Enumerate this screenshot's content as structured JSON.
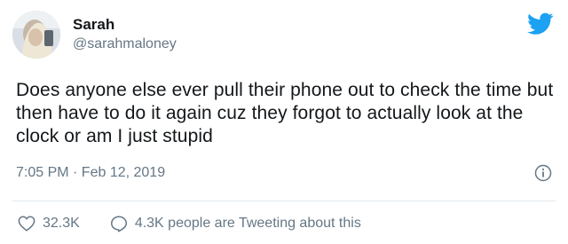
{
  "user": {
    "display_name": "Sarah",
    "handle": "@sarahmaloney",
    "avatar_icon": "profile-photo"
  },
  "tweet": {
    "text": "Does anyone else ever pull their phone out to check the time but then have to do it again cuz they forgot to actually look at the clock or am I just stupid",
    "timestamp": "7:05 PM · Feb 12, 2019"
  },
  "actions": {
    "likes": "32.3K",
    "tweeting": "4.3K people are Tweeting about this"
  },
  "colors": {
    "brand": "#1da1f2",
    "text": "#14171a",
    "muted": "#657786",
    "divider": "#e1e8ed"
  },
  "icons": [
    "twitter-bird-icon",
    "info-icon",
    "heart-icon",
    "comment-icon"
  ]
}
